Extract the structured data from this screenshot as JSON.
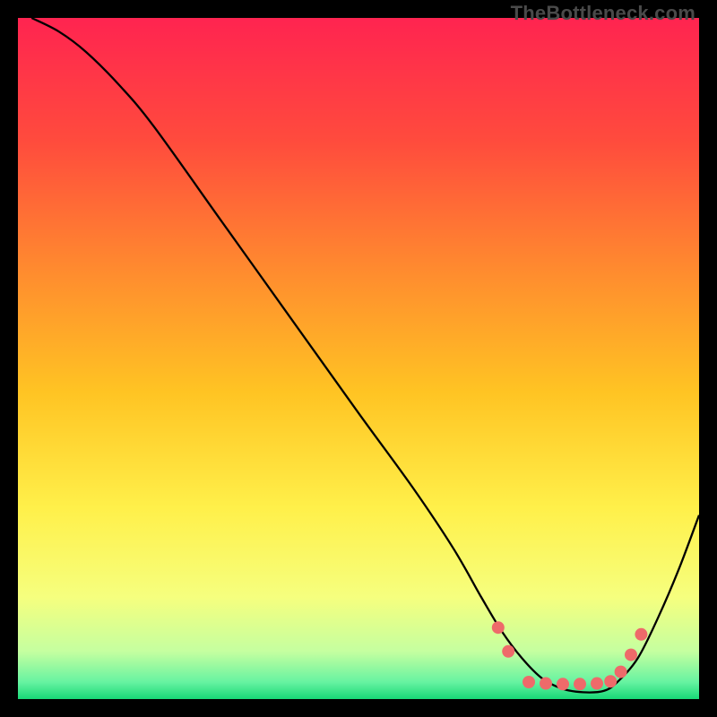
{
  "watermark": "TheBottleneck.com",
  "chart_data": {
    "type": "line",
    "title": "",
    "xlabel": "",
    "ylabel": "",
    "xlim": [
      0,
      100
    ],
    "ylim": [
      0,
      100
    ],
    "grid": false,
    "legend": false,
    "background_gradient": {
      "stops": [
        {
          "offset": 0.0,
          "color": "#ff2450"
        },
        {
          "offset": 0.18,
          "color": "#ff4b3d"
        },
        {
          "offset": 0.38,
          "color": "#ff8e2e"
        },
        {
          "offset": 0.55,
          "color": "#ffc423"
        },
        {
          "offset": 0.72,
          "color": "#fff04a"
        },
        {
          "offset": 0.85,
          "color": "#f6ff7e"
        },
        {
          "offset": 0.93,
          "color": "#c5ffa0"
        },
        {
          "offset": 0.975,
          "color": "#67f3a1"
        },
        {
          "offset": 1.0,
          "color": "#18d877"
        }
      ]
    },
    "series": [
      {
        "name": "curve",
        "color": "#000000",
        "width": 2.3,
        "x": [
          2,
          6,
          10,
          15,
          20,
          30,
          40,
          50,
          58,
          64,
          68,
          71,
          74,
          77,
          80,
          83,
          86,
          88,
          91,
          94,
          97,
          100
        ],
        "y": [
          100,
          98,
          95,
          90,
          84,
          70,
          56,
          42,
          31,
          22,
          15,
          10,
          6,
          3,
          1.5,
          1,
          1.2,
          2.5,
          6,
          12,
          19,
          27
        ]
      }
    ],
    "markers": {
      "name": "dots",
      "color": "#ee6a6a",
      "radius": 7,
      "points": [
        {
          "x": 70.5,
          "y": 10.5
        },
        {
          "x": 72.0,
          "y": 7.0
        },
        {
          "x": 75.0,
          "y": 2.5
        },
        {
          "x": 77.5,
          "y": 2.3
        },
        {
          "x": 80.0,
          "y": 2.2
        },
        {
          "x": 82.5,
          "y": 2.2
        },
        {
          "x": 85.0,
          "y": 2.3
        },
        {
          "x": 87.0,
          "y": 2.6
        },
        {
          "x": 88.5,
          "y": 4.0
        },
        {
          "x": 90.0,
          "y": 6.5
        },
        {
          "x": 91.5,
          "y": 9.5
        }
      ]
    }
  }
}
